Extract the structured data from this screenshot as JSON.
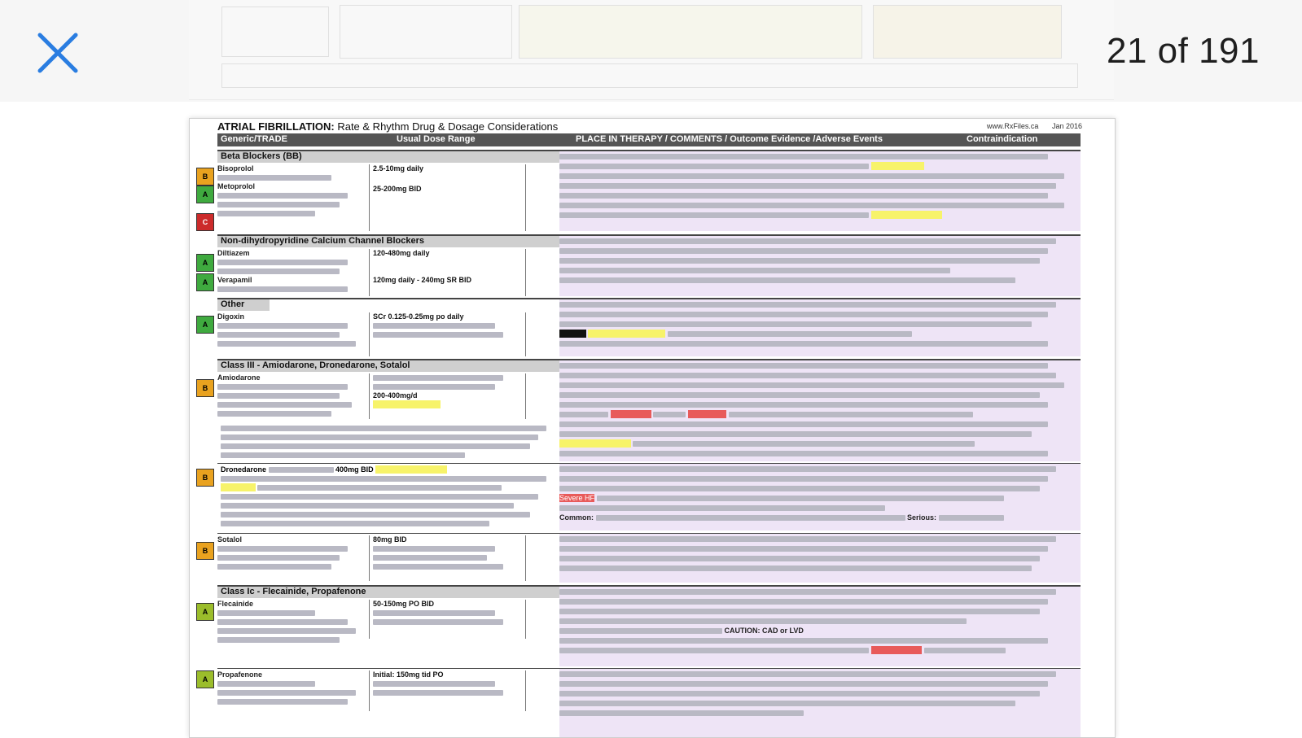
{
  "viewer": {
    "counter": "21 of 191",
    "close_icon": "close-x-icon",
    "accent_color": "#2a7de1"
  },
  "page": {
    "title_bold": "ATRIAL FIBRILLATION:",
    "title_rest": "Rate & Rhythm Drug & Dosage Considerations",
    "author": "Jan 2016",
    "website": "www.RxFiles.ca",
    "header": {
      "col1": "Generic/TRADE",
      "col2": "Usual Dose Range",
      "col3": "PLACE IN THERAPY / COMMENTS / Outcome Evidence /Adverse Events",
      "col4": "Contraindication"
    },
    "sections": [
      {
        "title": "Beta Blockers (BB)",
        "drugs": [
          "Bisoprolol",
          "Metoprolol"
        ],
        "doses": [
          "2.5-10mg daily",
          "25-200mg BID"
        ]
      },
      {
        "title": "Non-dihydropyridine Calcium Channel Blockers",
        "drugs": [
          "Diltiazem",
          "Verapamil"
        ],
        "doses": [
          "120-480mg daily",
          "120mg daily - 240mg SR BID"
        ]
      },
      {
        "title": "Other",
        "drugs": [
          "Digoxin"
        ],
        "doses": [
          "SCr 0.125-0.25mg po daily"
        ]
      },
      {
        "title": "Class III - Amiodarone, Dronedarone, Sotalol",
        "drugs": [
          "Amiodarone"
        ],
        "doses": [
          "200-400mg/d"
        ]
      },
      {
        "title": "",
        "drugs": [
          "Dronedarone"
        ],
        "doses": [
          "400mg BID"
        ]
      },
      {
        "title": "",
        "drugs": [
          "Sotalol"
        ],
        "doses": [
          "80mg BID"
        ]
      },
      {
        "title": "Class Ic - Flecainide, Propafenone",
        "drugs": [
          "Flecainide"
        ],
        "doses": [
          "50-150mg PO BID"
        ]
      },
      {
        "title": "",
        "drugs": [
          "Propafenone"
        ],
        "doses": [
          "Initial: 150mg tid PO"
        ]
      }
    ],
    "comment_labels": {
      "caution": "CAUTION: CAD or LVD",
      "severe_hf": "Severe HF",
      "common": "Common:",
      "serious": "Serious:"
    }
  }
}
